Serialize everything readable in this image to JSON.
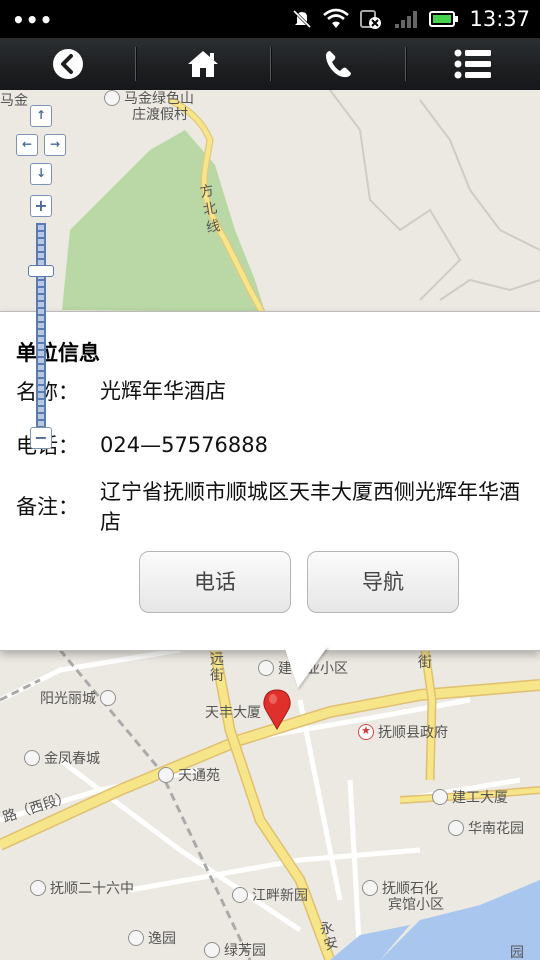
{
  "status_bar": {
    "time": "13:37",
    "icons": [
      "mute-icon",
      "wifi-icon",
      "sim-off-icon",
      "signal-icon",
      "battery-icon"
    ]
  },
  "nav": {
    "icons": [
      "back-icon",
      "home-icon",
      "phone-icon",
      "list-menu-icon"
    ]
  },
  "map": {
    "labels": {
      "top_left_fragment": "马金",
      "village_line1": "马金绿色山",
      "village_line2": "庄渡假村",
      "fangbei_road": "方北线",
      "yuan_street": "远街",
      "property_community": "建物业小区",
      "jie": "街",
      "yangguang": "阳光丽城",
      "tianfeng": "天丰大厦",
      "county_gov": "抚顺县政府",
      "jinfeng": "金凤春城",
      "tiantong": "天通苑",
      "jiangong": "建工大厦",
      "west_section": "路（西段）",
      "huanan": "华南花园",
      "school26": "抚顺二十六中",
      "jiangpan": "江畔新园",
      "petro1": "抚顺石化",
      "petro2": "宾馆小区",
      "yiyuan": "逸园",
      "lvfang": "绿芳园",
      "yongan": "永安",
      "bottom_right": "园"
    }
  },
  "info": {
    "title": "单位信息",
    "name_label": "名称：",
    "name_value": "光辉年华酒店",
    "phone_label": "电话：",
    "phone_value": "024—57576888",
    "note_label": "备注：",
    "note_value": "辽宁省抚顺市顺城区天丰大厦西侧光辉年华酒店",
    "call_button": "电话",
    "nav_button": "导航"
  },
  "colors": {
    "nav_bg": "#1c1e20",
    "road_yellow": "#f7e58a",
    "park_green": "#b9d8a5",
    "river_blue": "#a9c7ee",
    "marker_red": "#e0302b"
  }
}
